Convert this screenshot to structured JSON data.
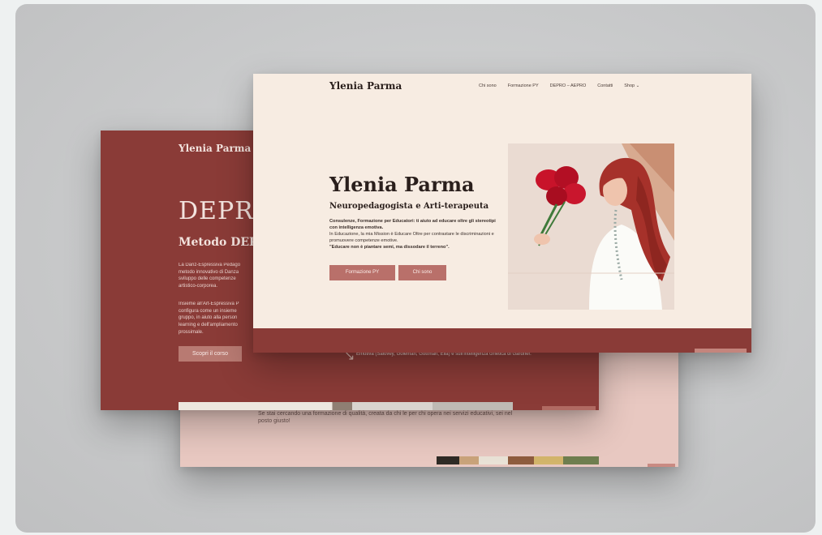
{
  "back_page": {
    "paragraph": "Se stai cercando una formazione di qualità, creata da chi le per chi opera nei servizi educativi, sei nel posto giusto!"
  },
  "middle_page": {
    "logo": "Ylenia Parma",
    "title": "DEPR",
    "subtitle": "Metodo DEPR",
    "paragraph_1": "La Danz-Espressiva Pedago metodo innovativo di Danza sviluppo delle competenze artistico-corporea.",
    "paragraph_2": "Insieme all'Art-Espressiva P configura come un insieme gruppo, in aiuto alla person learning e dell'ampliamento prossimale.",
    "button": "Scopri il corso",
    "caption": "Emotiva (Salovey, Goleman, Gottman, Elia) e sull'intelligenza cinetica di Gardner."
  },
  "front_page": {
    "logo": "Ylenia Parma",
    "nav": [
      "Chi sono",
      "Formazione PY",
      "DEPRO – AEPRO",
      "Contatti",
      "Shop ⌄"
    ],
    "hero_title": "Ylenia Parma",
    "hero_subtitle": "Neuropedagogista e Arti-terapeuta",
    "hero_line_1": "Consulenze, Formazione per Educatori: ti aiuto ad educare oltre gli stereotipi con intelligenza emotiva.",
    "hero_line_2": "In Educazione, la mia Mission è Educare Oltre per contrastare le discriminazioni e promuovere competenze emotive.",
    "hero_quote": "\"Educare non è piantare semi, ma dissodare il terreno\".",
    "button_primary": "Formazione PY",
    "button_secondary": "Chi sono"
  },
  "colors": {
    "maroon": "#8a3b37",
    "cream": "#f7ece2",
    "pink": "#e8c8c1",
    "button": "#b9706a"
  },
  "icons": [
    "arrow-icon",
    "chevron-down-icon"
  ]
}
